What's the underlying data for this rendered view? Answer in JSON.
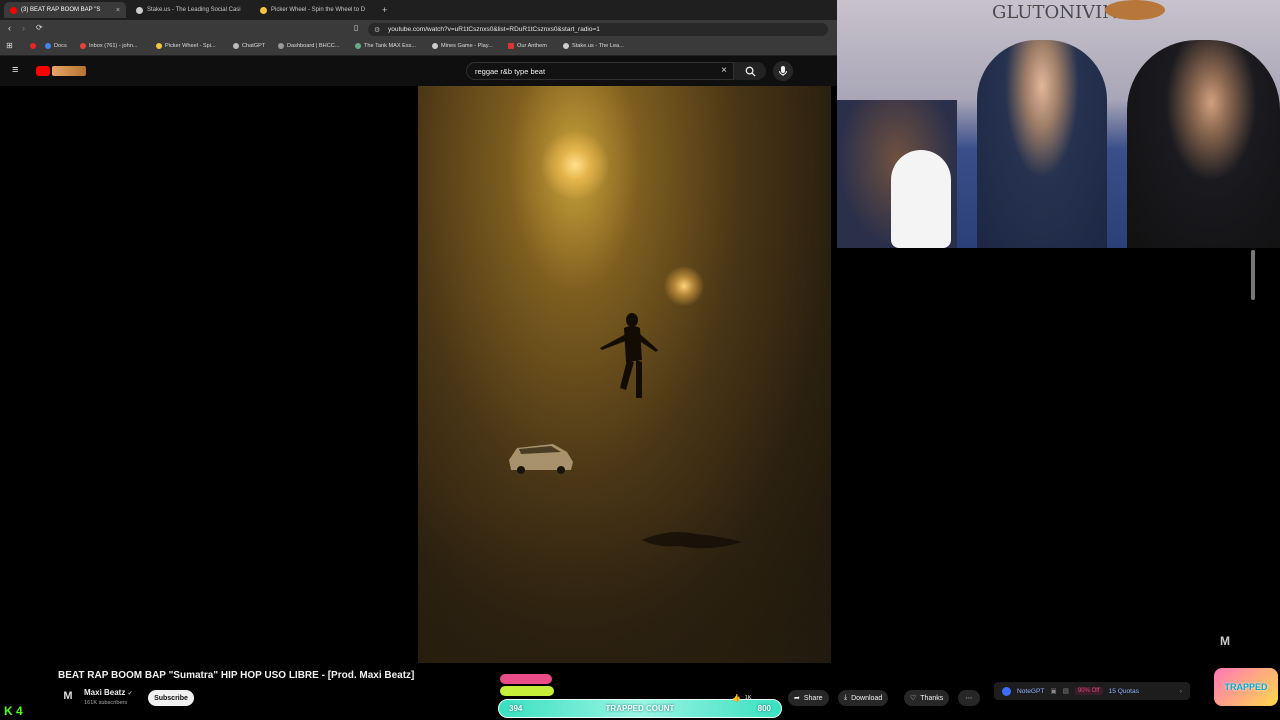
{
  "browser": {
    "tabs": [
      {
        "label": "(3) BEAT RAP BOOM BAP \"S",
        "active": true,
        "favicon_color": "#ff0000"
      },
      {
        "label": "Stake.us - The Leading Social Casi",
        "active": false,
        "favicon_color": "#cccccc"
      },
      {
        "label": "Picker Wheel - Spin the Wheel to D",
        "active": false,
        "favicon_color": "#f5c542"
      }
    ],
    "new_tab": "+",
    "close_glyph": "×",
    "url": "youtube.com/watch?v=uR1tCsznxs0&list=RDuR1tCsznxs0&start_radio=1",
    "bookmarks": [
      "Docs",
      "Inbox (761) - john...",
      "Picker Wheel - Spi...",
      "ChatGPT",
      "Dashboard | BHCC...",
      "The Tank MAX Ess...",
      "Mines Game - Play...",
      "Our Anthem",
      "Stake.us - The Lea..."
    ]
  },
  "youtube": {
    "search_value": "reggae r&b type beat",
    "video_title": "BEAT RAP BOOM BAP \"Sumatra\" HIP HOP USO LIBRE - [Prod. Maxi Beatz]",
    "channel_name": "Maxi Beatz",
    "subscribers": "161K subscribers",
    "subscribe_label": "Subscribe",
    "channel_logo": "M",
    "actions": {
      "like_count": "1K",
      "share": "Share",
      "download": "Download",
      "thanks": "Thanks",
      "more": "⋯"
    }
  },
  "overlay": {
    "counter_left": "394",
    "counter_label": "TRAPPED COUNT",
    "counter_right": "800",
    "trapped_logo": "TRAPPED",
    "kick_logo": "K 4"
  },
  "notegpt": {
    "label": "NoteGPT",
    "discount": "90% Off",
    "quota": "15 Quotas"
  },
  "webcam": {
    "wall_text": "GLUTONIVINI",
    "watermark": "M"
  },
  "colors": {
    "yt_bg": "#0f0f0f",
    "accent_red": "#ff0000",
    "counter_teal": "#39e0c0"
  }
}
